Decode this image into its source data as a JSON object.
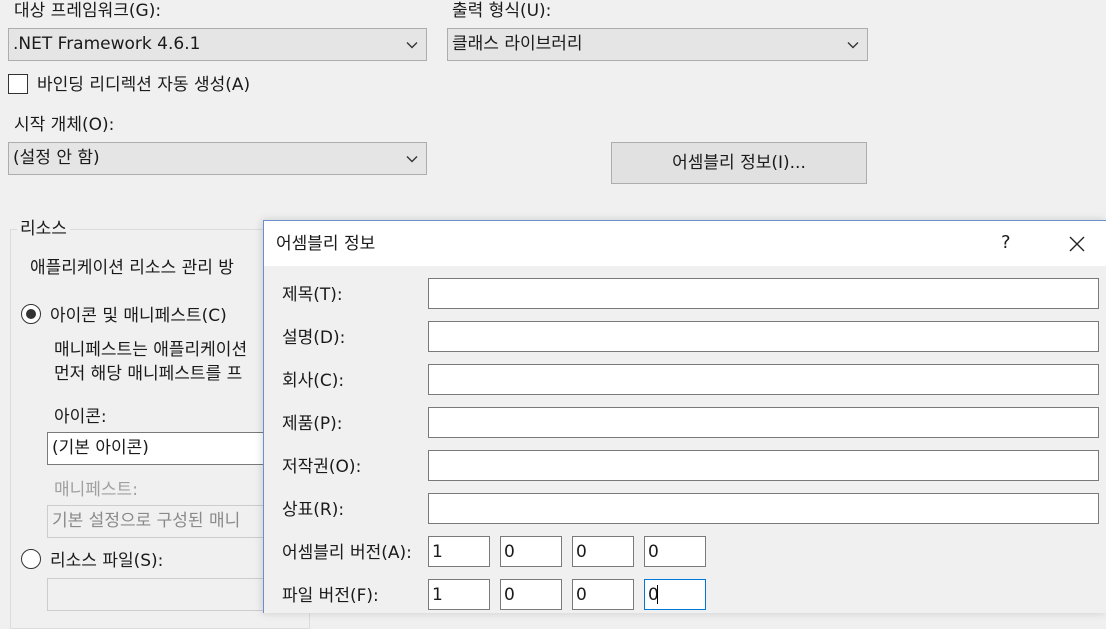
{
  "target_framework": {
    "label": "대상 프레임워크(G):",
    "value": ".NET Framework 4.6.1"
  },
  "output_type": {
    "label": "출력 형식(U):",
    "value": "클래스 라이브러리"
  },
  "auto_binding_redirect": {
    "label": "바인딩 리디렉션 자동 생성(A)",
    "checked": false
  },
  "startup_object": {
    "label": "시작 개체(O):",
    "value": "(설정 안 함)"
  },
  "assembly_info_button": "어셈블리 정보(I)...",
  "resources": {
    "group_label": "리소스",
    "description": "애플리케이션 리소스 관리 방",
    "icon_manifest_radio": {
      "label": "아이콘 및 매니페스트(C)",
      "selected": true
    },
    "manifest_desc_line1": "매니페스트는 애플리케이션",
    "manifest_desc_line2": "먼저 해당 매니페스트를 프",
    "icon_label": "아이콘:",
    "icon_value": "(기본 아이콘)",
    "manifest_label": "매니페스트:",
    "manifest_value": "기본 설정으로 구성된 매니",
    "resource_file_radio": {
      "label": "리소스 파일(S):",
      "selected": false
    },
    "resource_file_value": ""
  },
  "dialog": {
    "title": "어셈블리 정보",
    "help_symbol": "?",
    "fields": {
      "title_label": "제목(T):",
      "title_value": "",
      "description_label": "설명(D):",
      "description_value": "",
      "company_label": "회사(C):",
      "company_value": "",
      "product_label": "제품(P):",
      "product_value": "",
      "copyright_label": "저작권(O):",
      "copyright_value": "",
      "trademark_label": "상표(R):",
      "trademark_value": ""
    },
    "assembly_version": {
      "label": "어셈블리 버전(A):",
      "parts": [
        "1",
        "0",
        "0",
        "0"
      ]
    },
    "file_version": {
      "label": "파일 버전(F):",
      "parts": [
        "1",
        "0",
        "0",
        "0"
      ]
    }
  },
  "colors": {
    "accent": "#0078d7",
    "dialog_border": "#6b8fc9",
    "background": "#f0f0f0"
  }
}
